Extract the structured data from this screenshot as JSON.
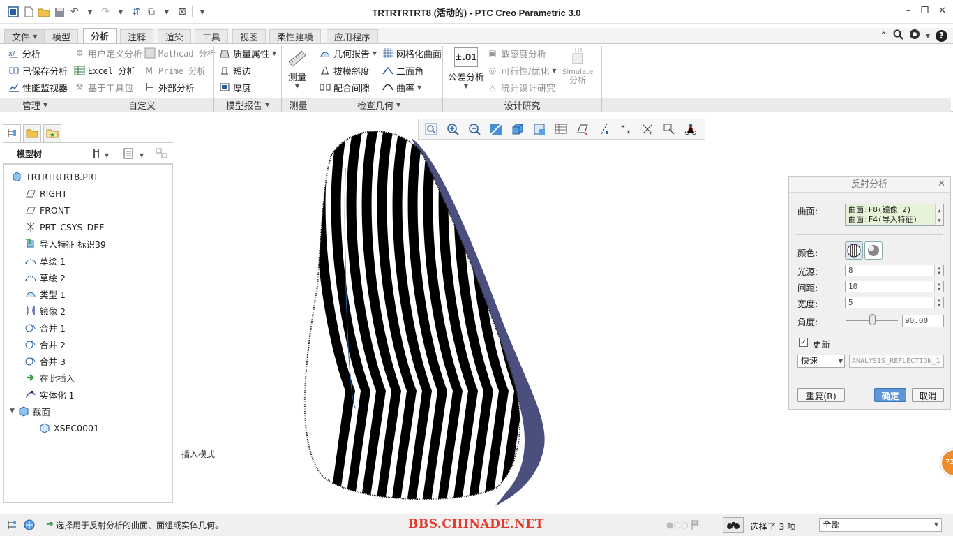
{
  "window": {
    "title": "TRTRTRTRT8 (活动的) - PTC Creo Parametric 3.0"
  },
  "tabs": [
    {
      "label": "文件",
      "id": "file"
    },
    {
      "label": "模型",
      "id": "model"
    },
    {
      "label": "分析",
      "id": "analysis"
    },
    {
      "label": "注释",
      "id": "annotate"
    },
    {
      "label": "渲染",
      "id": "render"
    },
    {
      "label": "工具",
      "id": "tools"
    },
    {
      "label": "视图",
      "id": "view"
    },
    {
      "label": "柔性建模",
      "id": "flex"
    },
    {
      "label": "应用程序",
      "id": "apps"
    }
  ],
  "ribbon": {
    "manage": {
      "items": [
        "分析",
        "已保存分析",
        "性能监视器"
      ],
      "footer": "管理"
    },
    "custom": {
      "items": [
        "用户定义分析",
        "Excel 分析",
        "基于工具包",
        "Mathcad 分析",
        "Prime 分析",
        "外部分析"
      ],
      "footer": "自定义"
    },
    "model_report": {
      "items": [
        "质量属性",
        "短边",
        "厚度"
      ],
      "footer": "模型报告"
    },
    "measure": {
      "label": "测量",
      "footer": "测量"
    },
    "inspect": {
      "items": [
        "几何报告",
        "拔模斜度",
        "配合间隙",
        "网格化曲面",
        "二面角",
        "曲率"
      ],
      "footer": "检查几何"
    },
    "design_study": {
      "tolerance_label": "公差分析",
      "tolerance_icon_text": "±.01",
      "items": [
        "敏感度分析",
        "可行性/优化",
        "统计设计研究"
      ],
      "simulate_line1": "Simulate",
      "simulate_line2": "分析",
      "footer": "设计研究"
    }
  },
  "left_panel": {
    "header": "模型树",
    "tree": [
      {
        "label": "TRTRTRTRT8.PRT",
        "icon": "part-icon",
        "indent": 0
      },
      {
        "label": "RIGHT",
        "icon": "plane-icon",
        "indent": 1
      },
      {
        "label": "FRONT",
        "icon": "plane-icon",
        "indent": 1
      },
      {
        "label": "PRT_CSYS_DEF",
        "icon": "csys-icon",
        "indent": 1
      },
      {
        "label": "导入特征 标识39",
        "icon": "import-feature-icon",
        "indent": 1
      },
      {
        "label": "草绘 1",
        "icon": "sketch-icon",
        "indent": 1
      },
      {
        "label": "草绘 2",
        "icon": "sketch-icon",
        "indent": 1
      },
      {
        "label": "类型 1",
        "icon": "style-icon",
        "indent": 1
      },
      {
        "label": "镜像 2",
        "icon": "mirror-icon",
        "indent": 1
      },
      {
        "label": "合并 1",
        "icon": "merge-icon",
        "indent": 1
      },
      {
        "label": "合并 2",
        "icon": "merge-icon",
        "indent": 1
      },
      {
        "label": "合并 3",
        "icon": "merge-icon",
        "indent": 1
      },
      {
        "label": "在此插入",
        "icon": "insert-here-icon",
        "indent": 1
      },
      {
        "label": "实体化 1",
        "icon": "solidify-icon",
        "indent": 1
      },
      {
        "label": "截面",
        "icon": "section-icon",
        "indent": 0
      },
      {
        "label": "XSEC0001",
        "icon": "xsec-icon",
        "indent": 2
      }
    ]
  },
  "graphics": {
    "mode_label": "插入模式"
  },
  "dialog": {
    "title": "反射分析",
    "surface_label": "曲面:",
    "surfaces": [
      "曲面:F8(镜像_2)",
      "曲面:F4(导入特征)"
    ],
    "color_label": "颜色:",
    "light_label": "光源:",
    "light_value": "8",
    "spacing_label": "间距:",
    "spacing_value": "10",
    "width_label": "宽度:",
    "width_value": "5",
    "angle_label": "角度:",
    "angle_value": "90.00",
    "update_label": "更新",
    "mode_value": "快速",
    "analysis_name": "ANALYSIS_REFLECTION_1",
    "repeat_label": "重复(R)",
    "ok_label": "确定",
    "cancel_label": "取消"
  },
  "status": {
    "message": "选择用于反射分析的曲面、面组或实体几何。",
    "watermark": "BBS.CHINADE.NET",
    "selected": "选择了 3 项",
    "filter": "全部",
    "badge": "73"
  },
  "colors": {
    "accent": "#2b5e9b",
    "ok_button": "#5d95d9",
    "watermark": "#e5392e",
    "model_edge": "#4b4f7e"
  }
}
